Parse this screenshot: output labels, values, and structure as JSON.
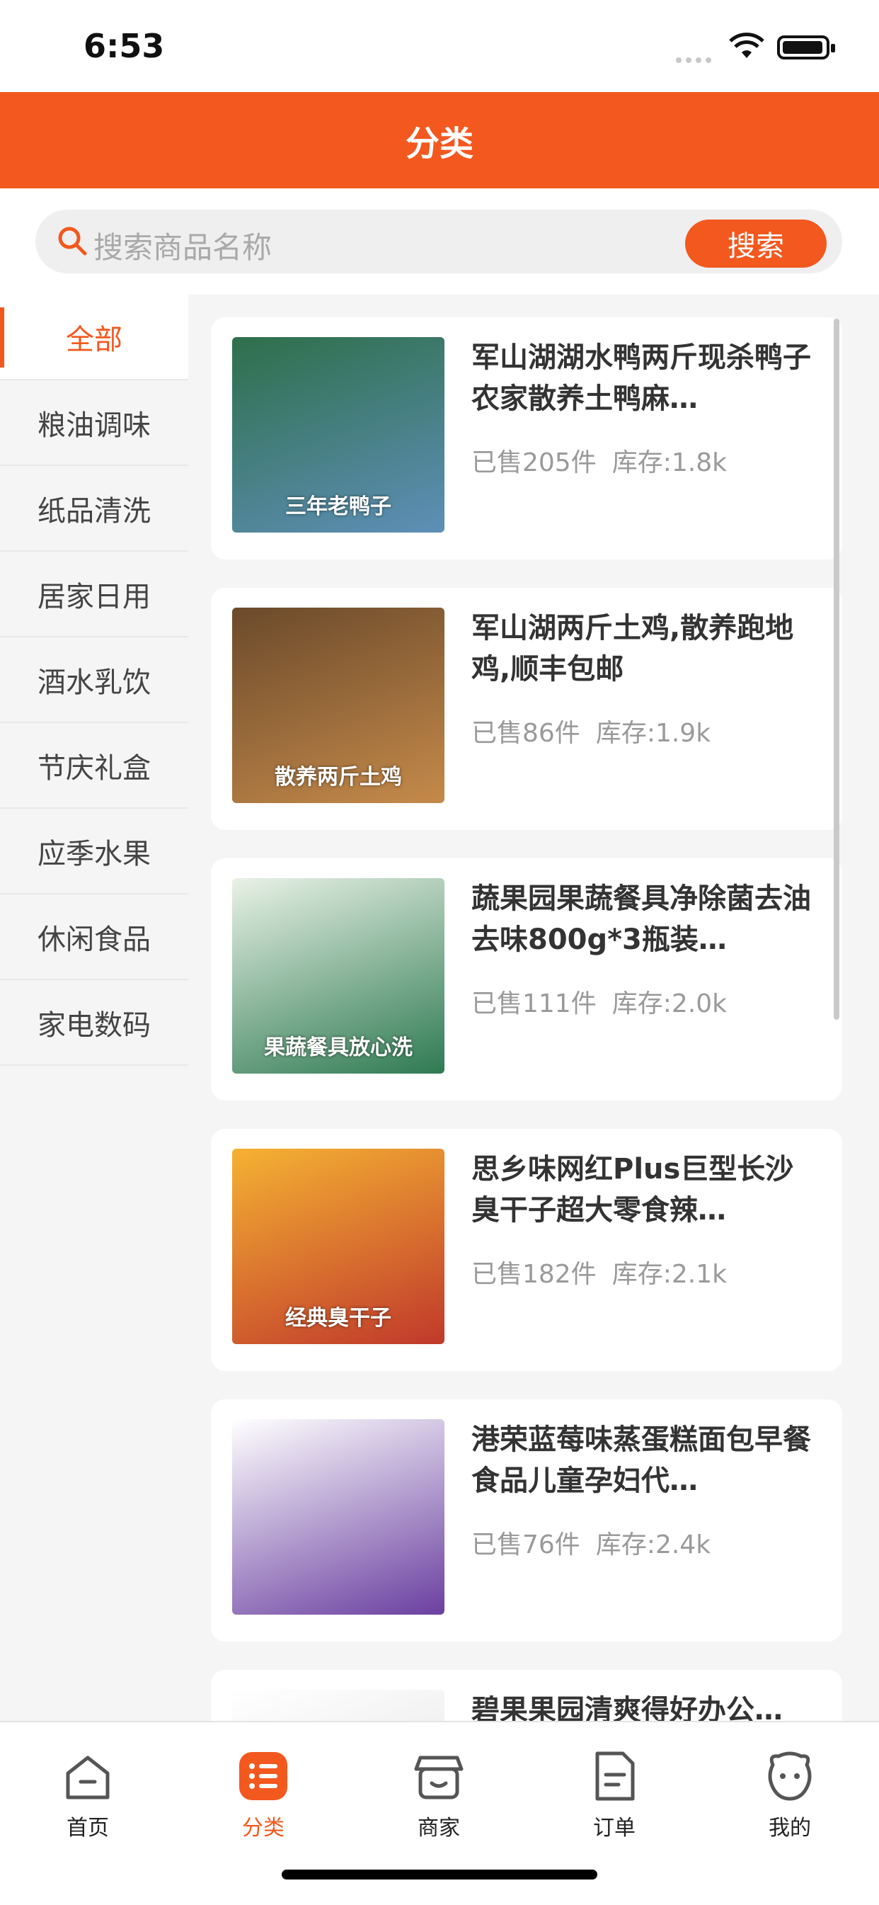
{
  "status_bar": {
    "time": "6:53"
  },
  "header": {
    "title": "分类"
  },
  "search": {
    "placeholder": "搜索商品名称",
    "button_label": "搜索"
  },
  "sidebar": {
    "items": [
      {
        "label": "全部",
        "active": true
      },
      {
        "label": "粮油调味"
      },
      {
        "label": "纸品清洗"
      },
      {
        "label": "居家日用"
      },
      {
        "label": "酒水乳饮"
      },
      {
        "label": "节庆礼盒"
      },
      {
        "label": "应季水果"
      },
      {
        "label": "休闲食品"
      },
      {
        "label": "家电数码"
      }
    ]
  },
  "products": [
    {
      "name": "军山湖湖水鸭两斤现杀鸭子农家散养土鸭麻…",
      "sold": "已售205件",
      "stock": "库存:1.8k",
      "thumb_text": "三年老鸭子",
      "thumb_colors": [
        "#2f6f4a",
        "#5e8fb8"
      ]
    },
    {
      "name": "军山湖两斤土鸡,散养跑地鸡,顺丰包邮",
      "sold": "已售86件",
      "stock": "库存:1.9k",
      "thumb_text": "散养两斤土鸡",
      "thumb_colors": [
        "#6b4a2b",
        "#c58a4a"
      ]
    },
    {
      "name": "蔬果园果蔬餐具净除菌去油去味800g*3瓶装…",
      "sold": "已售111件",
      "stock": "库存:2.0k",
      "thumb_text": "果蔬餐具放心洗",
      "thumb_colors": [
        "#e9f2e6",
        "#2e7a52"
      ]
    },
    {
      "name": "思乡味网红Plus巨型长沙臭干子超大零食辣…",
      "sold": "已售182件",
      "stock": "库存:2.1k",
      "thumb_text": "经典臭干子",
      "thumb_colors": [
        "#f5b233",
        "#c0392b"
      ]
    },
    {
      "name": "港荣蓝莓味蒸蛋糕面包早餐食品儿童孕妇代…",
      "sold": "已售76件",
      "stock": "库存:2.4k",
      "thumb_text": "",
      "thumb_colors": [
        "#ffffff",
        "#6a3fa0"
      ]
    },
    {
      "name": "碧果果园清爽得好办公…",
      "sold": "",
      "stock": "",
      "thumb_text": "",
      "thumb_colors": [
        "#ffffff",
        "#dddddd"
      ]
    }
  ],
  "tabbar": {
    "items": [
      {
        "label": "首页",
        "icon": "home-icon"
      },
      {
        "label": "分类",
        "icon": "list-icon",
        "active": true
      },
      {
        "label": "商家",
        "icon": "store-icon"
      },
      {
        "label": "订单",
        "icon": "document-icon"
      },
      {
        "label": "我的",
        "icon": "face-icon"
      }
    ]
  },
  "colors": {
    "accent": "#f3581e",
    "background": "#f5f5f5"
  }
}
